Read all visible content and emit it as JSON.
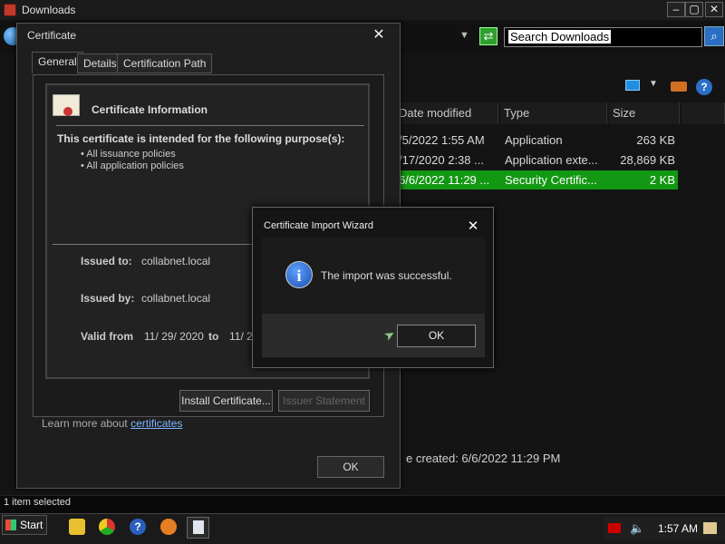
{
  "explorer": {
    "title": "Downloads",
    "window_controls": {
      "minimize": "–",
      "maximize": "▢",
      "close": "✕"
    },
    "search_placeholder": "Search Downloads",
    "columns": [
      "Date modified",
      "Type",
      "Size"
    ],
    "rows": [
      {
        "date": "/5/2022 1:55 AM",
        "type": "Application",
        "size": "263 KB",
        "selected": false
      },
      {
        "date": "/17/2020 2:38 ...",
        "type": "Application exte...",
        "size": "28,869 KB",
        "selected": false
      },
      {
        "date": "6/6/2022 11:29 ...",
        "type": "Security Certific...",
        "size": "2 KB",
        "selected": true
      }
    ],
    "details_text": "e created: 6/6/2022 11:29 PM",
    "status_text": "1 item selected"
  },
  "taskbar": {
    "start_label": "Start",
    "clock": "1:57 AM"
  },
  "certificate": {
    "title": "Certificate",
    "tabs": [
      "General",
      "Details",
      "Certification Path"
    ],
    "info_title": "Certificate Information",
    "purpose_title": "This certificate is intended for the following purpose(s):",
    "purposes": [
      "• All issuance policies",
      "• All application policies"
    ],
    "issued_to_label": "Issued to:",
    "issued_to_value": "collabnet.local",
    "issued_by_label": "Issued by:",
    "issued_by_value": "collabnet.local",
    "valid_from_label": "Valid from",
    "valid_from_value": "11/ 29/ 2020",
    "valid_to_label": "to",
    "valid_to_value": "11/ 2",
    "install_button": "Install Certificate...",
    "issuer_button": "Issuer Statement",
    "learn_prefix": "Learn more about ",
    "learn_link": "certificates",
    "ok_button": "OK"
  },
  "wizard": {
    "title": "Certificate Import Wizard",
    "message": "The import was successful.",
    "ok_button": "OK",
    "icon": "i"
  }
}
